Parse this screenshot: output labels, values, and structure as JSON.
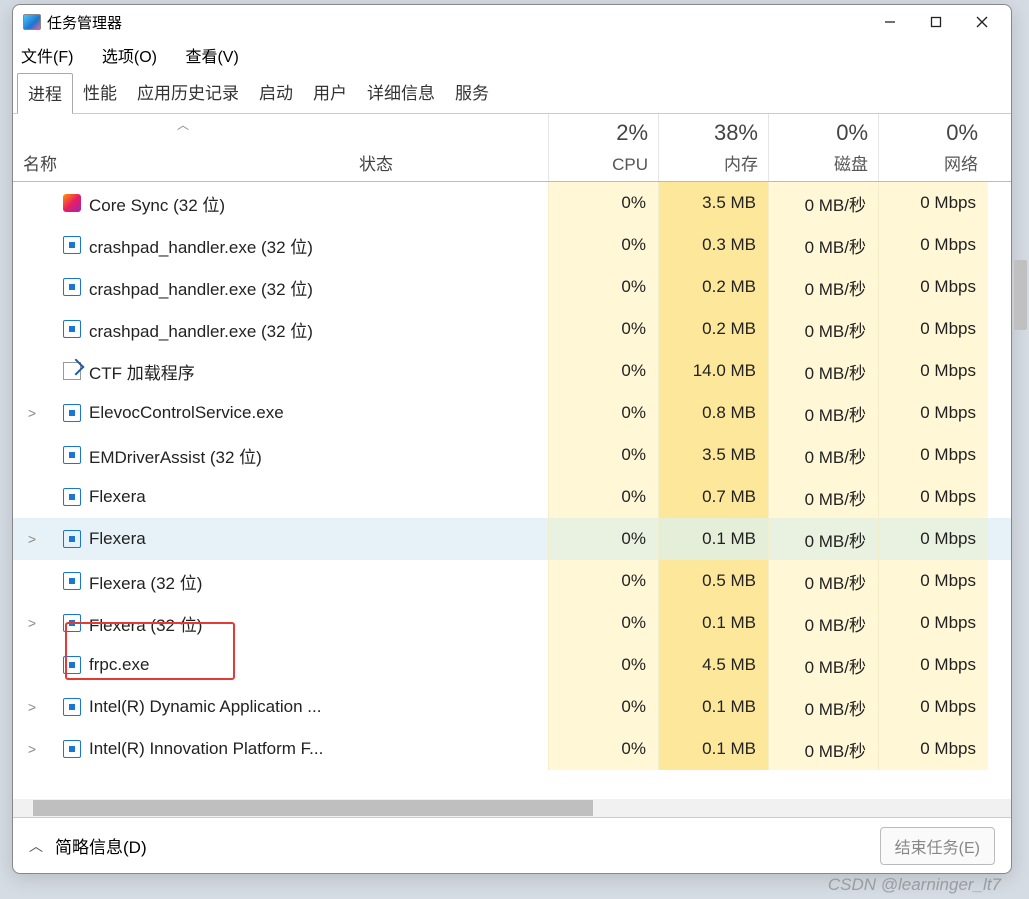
{
  "window": {
    "title": "任务管理器"
  },
  "menubar": {
    "file": "文件(F)",
    "options": "选项(O)",
    "view": "查看(V)"
  },
  "tabs": [
    "进程",
    "性能",
    "应用历史记录",
    "启动",
    "用户",
    "详细信息",
    "服务"
  ],
  "active_tab": 0,
  "columns": {
    "name": "名称",
    "status": "状态",
    "cpu": {
      "pct": "2%",
      "label": "CPU"
    },
    "mem": {
      "pct": "38%",
      "label": "内存"
    },
    "disk": {
      "pct": "0%",
      "label": "磁盘"
    },
    "net": {
      "pct": "0%",
      "label": "网络"
    }
  },
  "rows": [
    {
      "exp": "",
      "icon": "coresync",
      "name": "Core Sync (32 位)",
      "cpu": "0%",
      "mem": "3.5 MB",
      "disk": "0 MB/秒",
      "net": "0 Mbps",
      "sel": false,
      "hotmem": true
    },
    {
      "exp": "",
      "icon": "generic",
      "name": "crashpad_handler.exe (32 位)",
      "cpu": "0%",
      "mem": "0.3 MB",
      "disk": "0 MB/秒",
      "net": "0 Mbps",
      "sel": false,
      "hotmem": true
    },
    {
      "exp": "",
      "icon": "generic",
      "name": "crashpad_handler.exe (32 位)",
      "cpu": "0%",
      "mem": "0.2 MB",
      "disk": "0 MB/秒",
      "net": "0 Mbps",
      "sel": false,
      "hotmem": true
    },
    {
      "exp": "",
      "icon": "generic",
      "name": "crashpad_handler.exe (32 位)",
      "cpu": "0%",
      "mem": "0.2 MB",
      "disk": "0 MB/秒",
      "net": "0 Mbps",
      "sel": false,
      "hotmem": true
    },
    {
      "exp": "",
      "icon": "ctf",
      "name": "CTF 加载程序",
      "cpu": "0%",
      "mem": "14.0 MB",
      "disk": "0 MB/秒",
      "net": "0 Mbps",
      "sel": false,
      "hotmem": true
    },
    {
      "exp": ">",
      "icon": "generic",
      "name": "ElevocControlService.exe",
      "cpu": "0%",
      "mem": "0.8 MB",
      "disk": "0 MB/秒",
      "net": "0 Mbps",
      "sel": false,
      "hotmem": true
    },
    {
      "exp": "",
      "icon": "generic",
      "name": "EMDriverAssist (32 位)",
      "cpu": "0%",
      "mem": "3.5 MB",
      "disk": "0 MB/秒",
      "net": "0 Mbps",
      "sel": false,
      "hotmem": true
    },
    {
      "exp": "",
      "icon": "generic",
      "name": "Flexera",
      "cpu": "0%",
      "mem": "0.7 MB",
      "disk": "0 MB/秒",
      "net": "0 Mbps",
      "sel": false,
      "hotmem": true
    },
    {
      "exp": ">",
      "icon": "generic",
      "name": "Flexera",
      "cpu": "0%",
      "mem": "0.1 MB",
      "disk": "0 MB/秒",
      "net": "0 Mbps",
      "sel": true,
      "hotmem": true
    },
    {
      "exp": "",
      "icon": "generic",
      "name": "Flexera (32 位)",
      "cpu": "0%",
      "mem": "0.5 MB",
      "disk": "0 MB/秒",
      "net": "0 Mbps",
      "sel": false,
      "hotmem": true
    },
    {
      "exp": ">",
      "icon": "generic",
      "name": "Flexera (32 位)",
      "cpu": "0%",
      "mem": "0.1 MB",
      "disk": "0 MB/秒",
      "net": "0 Mbps",
      "sel": false,
      "hotmem": true
    },
    {
      "exp": "",
      "icon": "generic",
      "name": "frpc.exe",
      "cpu": "0%",
      "mem": "4.5 MB",
      "disk": "0 MB/秒",
      "net": "0 Mbps",
      "sel": false,
      "hotmem": true,
      "boxed": true
    },
    {
      "exp": ">",
      "icon": "generic",
      "name": "Intel(R) Dynamic Application ...",
      "cpu": "0%",
      "mem": "0.1 MB",
      "disk": "0 MB/秒",
      "net": "0 Mbps",
      "sel": false,
      "hotmem": true
    },
    {
      "exp": ">",
      "icon": "generic",
      "name": "Intel(R) Innovation Platform F...",
      "cpu": "0%",
      "mem": "0.1 MB",
      "disk": "0 MB/秒",
      "net": "0 Mbps",
      "sel": false,
      "hotmem": true
    }
  ],
  "footer": {
    "fewer": "简略信息(D)",
    "end_task": "结束任务(E)"
  },
  "watermark": "CSDN @learninger_lt7"
}
